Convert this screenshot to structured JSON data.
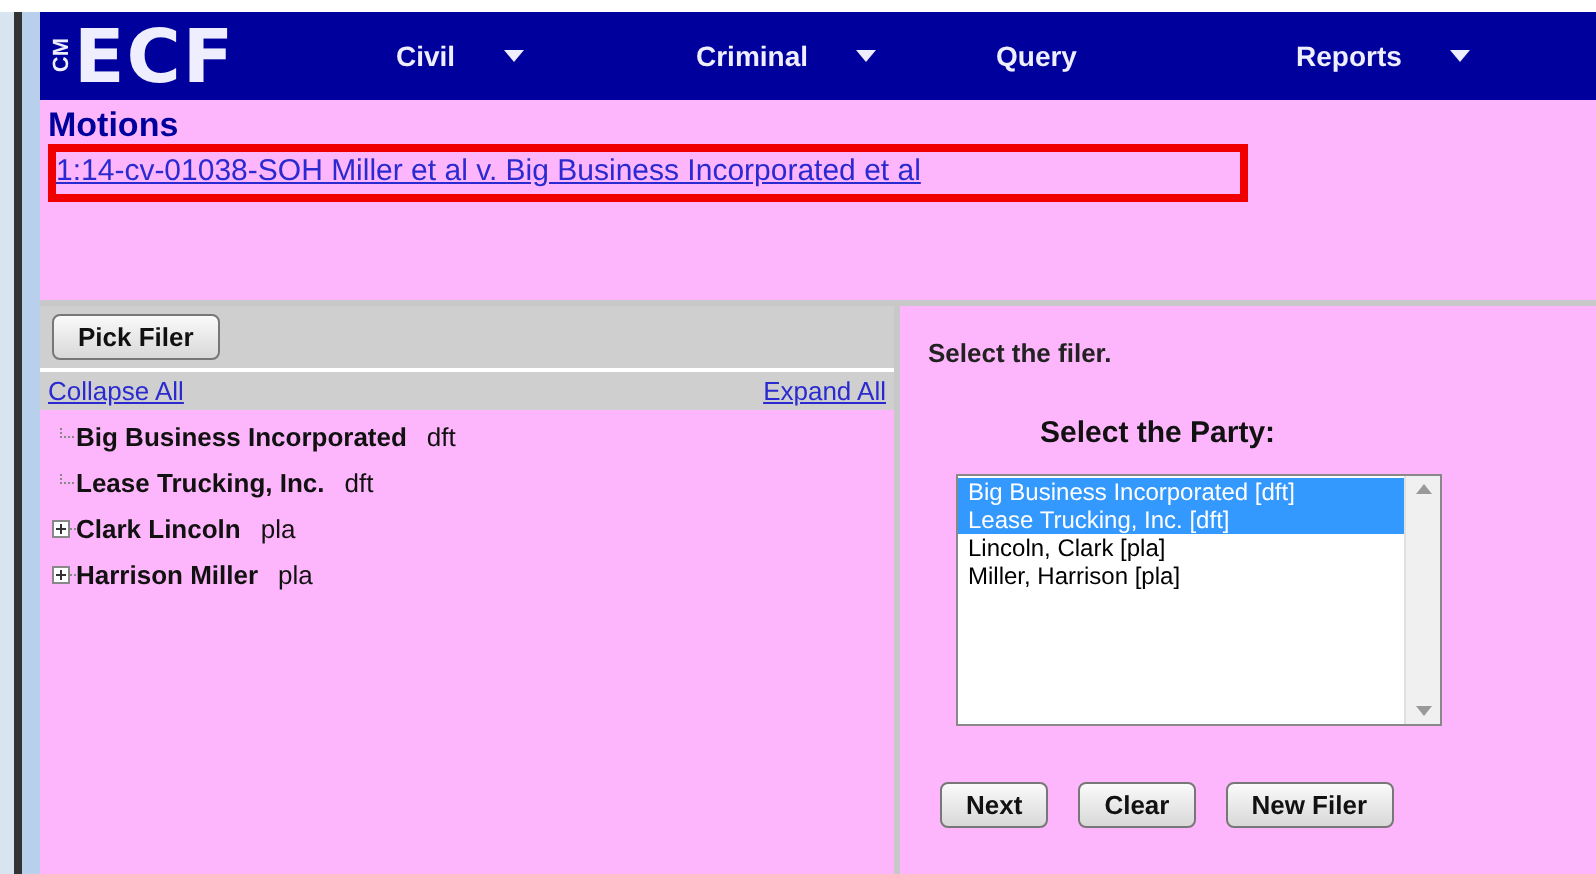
{
  "header": {
    "logo_small": "CM",
    "logo": "ECF",
    "menu": [
      {
        "label": "Civil",
        "dropdown": true
      },
      {
        "label": "Criminal",
        "dropdown": true
      },
      {
        "label": "Query",
        "dropdown": false
      },
      {
        "label": "Reports",
        "dropdown": true
      }
    ]
  },
  "page": {
    "title": "Motions",
    "case_link": "1:14-cv-01038-SOH Miller et al v. Big Business Incorporated et al",
    "case_link_highlighted": true
  },
  "left_panel": {
    "button": "Pick Filer",
    "collapse_all": "Collapse All",
    "expand_all": "Expand All",
    "tree": [
      {
        "kind": "leaf",
        "name": "Big Business Incorporated",
        "role": "dft"
      },
      {
        "kind": "leaf",
        "name": "Lease Trucking, Inc.",
        "role": "dft"
      },
      {
        "kind": "collapsed",
        "name": "Clark Lincoln",
        "role": "pla"
      },
      {
        "kind": "collapsed",
        "name": "Harrison Miller",
        "role": "pla"
      }
    ]
  },
  "right_panel": {
    "instruction": "Select the filer.",
    "party_label": "Select the Party:",
    "parties": [
      {
        "label": "Big Business Incorporated [dft]",
        "selected": true
      },
      {
        "label": "Lease Trucking, Inc. [dft]",
        "selected": true
      },
      {
        "label": "Lincoln, Clark [pla]",
        "selected": false
      },
      {
        "label": "Miller, Harrison [pla]",
        "selected": false
      }
    ],
    "buttons": [
      "Next",
      "Clear",
      "New Filer"
    ]
  }
}
